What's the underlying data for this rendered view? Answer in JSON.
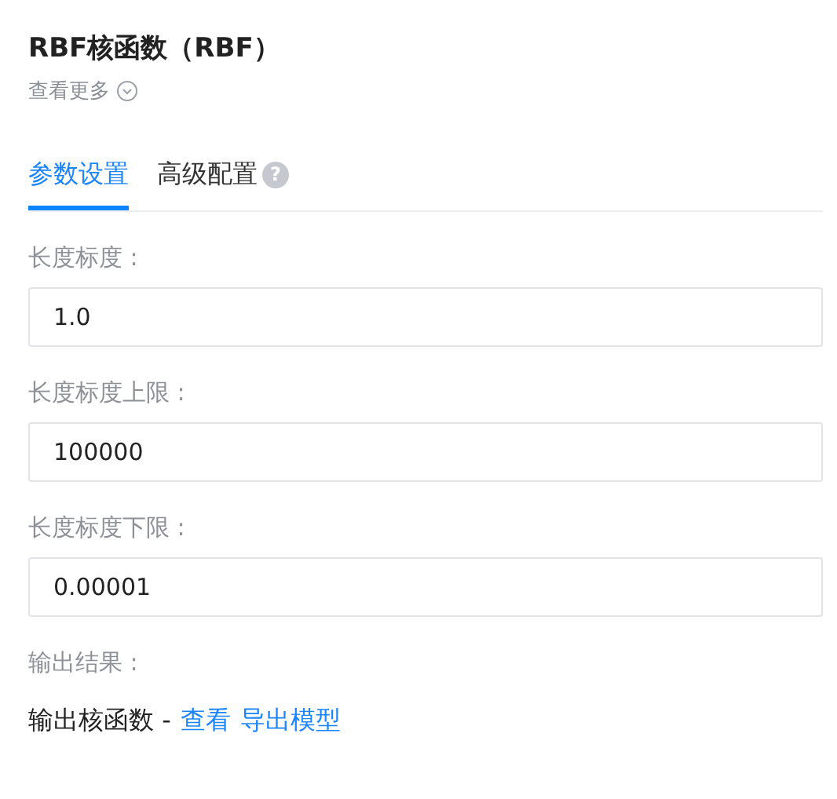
{
  "title": "RBF核函数（RBF）",
  "more_link": {
    "label": "查看更多"
  },
  "tabs": [
    {
      "label": "参数设置",
      "selected": true
    },
    {
      "label": "高级配置",
      "selected": false,
      "help": "?"
    }
  ],
  "fields": [
    {
      "label": "长度标度 :",
      "value": "1.0"
    },
    {
      "label": "长度标度上限 :",
      "value": "100000"
    },
    {
      "label": "长度标度下限 :",
      "value": "0.00001"
    }
  ],
  "output": {
    "label": "输出结果 :",
    "text": "输出核函数 -",
    "links": [
      "查看",
      "导出模型"
    ]
  }
}
